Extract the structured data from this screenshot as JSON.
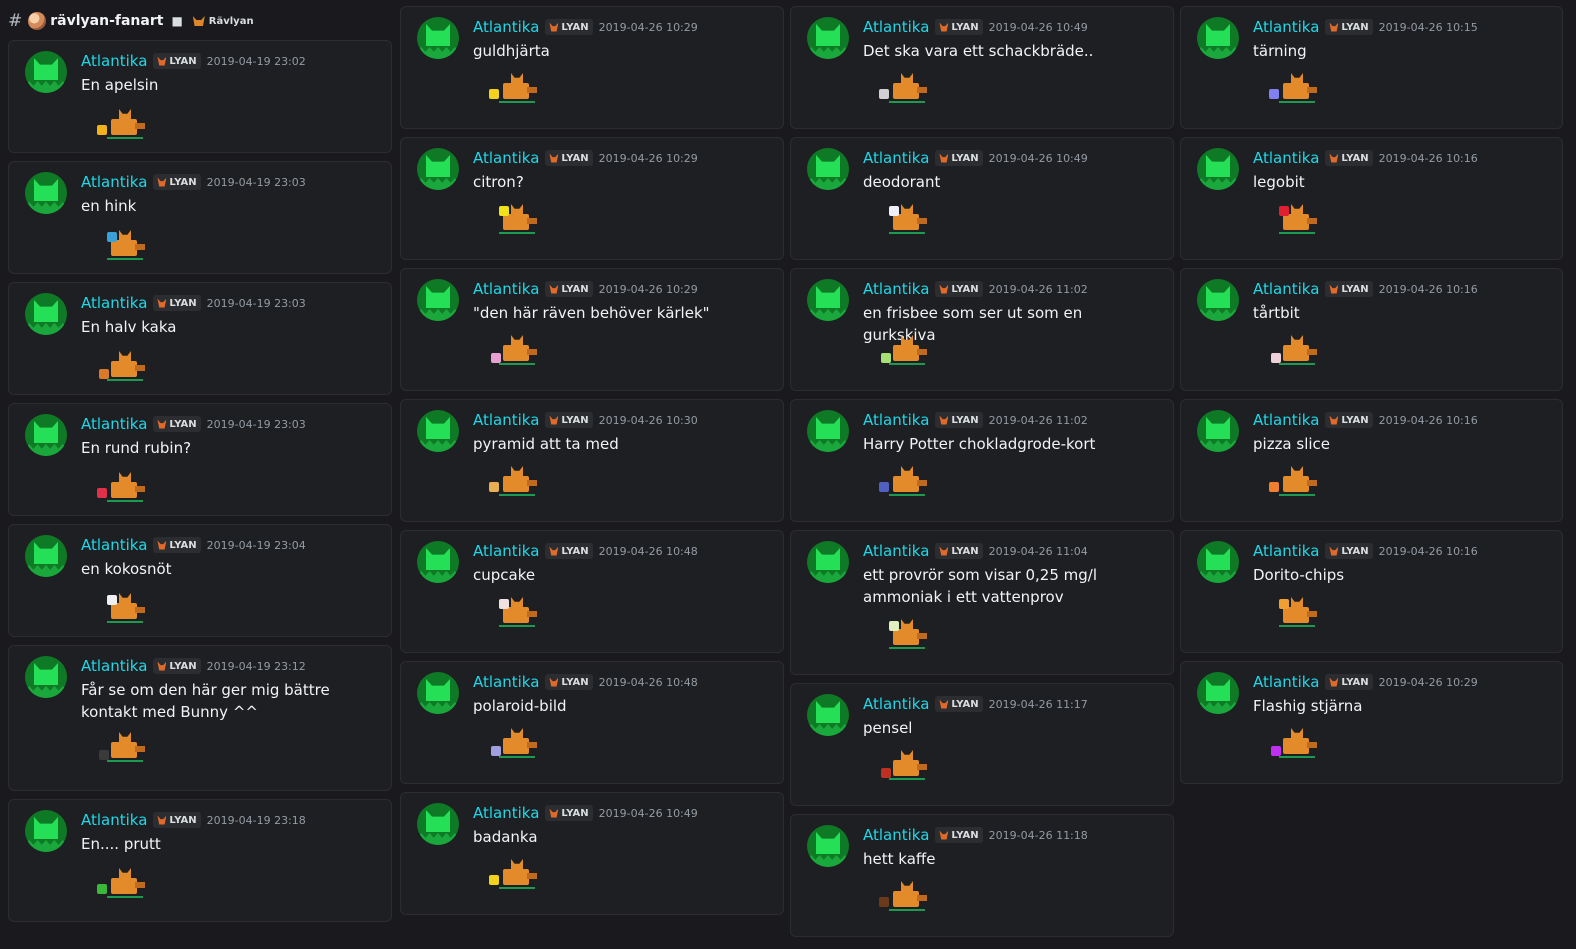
{
  "channel": {
    "hash": "#",
    "name": "rävlyan-fanart",
    "category": "Rävlyan"
  },
  "badge_label": "LYAN",
  "columns": [
    [
      {
        "user": "Atlantika",
        "time": "2019-04-19 23:02",
        "text": "En apelsin",
        "item_color": "#f2b21a"
      },
      {
        "user": "Atlantika",
        "time": "2019-04-19 23:03",
        "text": "en hink",
        "item_color": "#3aa0d8"
      },
      {
        "user": "Atlantika",
        "time": "2019-04-19 23:03",
        "text": "En halv kaka",
        "item_color": "#d87a2a"
      },
      {
        "user": "Atlantika",
        "time": "2019-04-19 23:03",
        "text": "En rund rubin?",
        "item_color": "#e0304a"
      },
      {
        "user": "Atlantika",
        "time": "2019-04-19 23:04",
        "text": "en kokosnöt",
        "item_color": "#f0f0f0"
      },
      {
        "user": "Atlantika",
        "time": "2019-04-19 23:12",
        "text": "Får se om den här ger mig bättre kontakt med Bunny ^^",
        "item_color": "#3a3a3a"
      },
      {
        "user": "Atlantika",
        "time": "2019-04-19 23:18",
        "text": "En.... prutt",
        "item_color": "#3ab83a"
      }
    ],
    [
      {
        "user": "Atlantika",
        "time": "2019-04-26 10:29",
        "text": "guldhjärta",
        "item_color": "#f2d21a"
      },
      {
        "user": "Atlantika",
        "time": "2019-04-26 10:29",
        "text": "citron?",
        "item_color": "#f2e21a"
      },
      {
        "user": "Atlantika",
        "time": "2019-04-26 10:29",
        "text": "\"den här räven behöver kärlek\"",
        "item_color": "#e8a0d0"
      },
      {
        "user": "Atlantika",
        "time": "2019-04-26 10:30",
        "text": "pyramid att ta med",
        "item_color": "#e8b050"
      },
      {
        "user": "Atlantika",
        "time": "2019-04-26 10:48",
        "text": "cupcake",
        "item_color": "#f0e0e0"
      },
      {
        "user": "Atlantika",
        "time": "2019-04-26 10:48",
        "text": "polaroid-bild",
        "item_color": "#a0a0e0"
      },
      {
        "user": "Atlantika",
        "time": "2019-04-26 10:49",
        "text": "badanka",
        "item_color": "#f2d21a"
      }
    ],
    [
      {
        "user": "Atlantika",
        "time": "2019-04-26 10:49",
        "text": "Det ska vara ett schackbräde..",
        "item_color": "#d0d0d0"
      },
      {
        "user": "Atlantika",
        "time": "2019-04-26 10:49",
        "text": "deodorant",
        "item_color": "#f0f0f8"
      },
      {
        "user": "Atlantika",
        "time": "2019-04-26 11:02",
        "text": "en frisbee som ser ut som en gurkskiva",
        "item_color": "#a8e078"
      },
      {
        "user": "Atlantika",
        "time": "2019-04-26 11:02",
        "text": "Harry Potter chokladgrode-kort",
        "item_color": "#5060c0"
      },
      {
        "user": "Atlantika",
        "time": "2019-04-26 11:04",
        "text": "ett provrör som visar 0,25 mg/l ammoniak i ett vattenprov",
        "item_color": "#e0f0c0"
      },
      {
        "user": "Atlantika",
        "time": "2019-04-26 11:17",
        "text": "pensel",
        "item_color": "#c03020"
      },
      {
        "user": "Atlantika",
        "time": "2019-04-26 11:18",
        "text": "hett kaffe",
        "item_color": "#6a3a1a"
      }
    ],
    [
      {
        "user": "Atlantika",
        "time": "2019-04-26 10:15",
        "text": "tärning",
        "item_color": "#8080f0"
      },
      {
        "user": "Atlantika",
        "time": "2019-04-26 10:16",
        "text": "legobit",
        "item_color": "#e02030"
      },
      {
        "user": "Atlantika",
        "time": "2019-04-26 10:16",
        "text": "tårtbit",
        "item_color": "#f0d0d8"
      },
      {
        "user": "Atlantika",
        "time": "2019-04-26 10:16",
        "text": "pizza slice",
        "item_color": "#f08030"
      },
      {
        "user": "Atlantika",
        "time": "2019-04-26 10:16",
        "text": "Dorito-chips",
        "item_color": "#f0a030"
      },
      {
        "user": "Atlantika",
        "time": "2019-04-26 10:29",
        "text": "Flashig stjärna",
        "item_color": "#c030f0"
      }
    ]
  ],
  "colors": {
    "background": "#1a1a1e",
    "card": "#1e1f22",
    "username": "#1fd8e8",
    "timestamp": "#949ba4",
    "text": "#f2f3f5"
  }
}
